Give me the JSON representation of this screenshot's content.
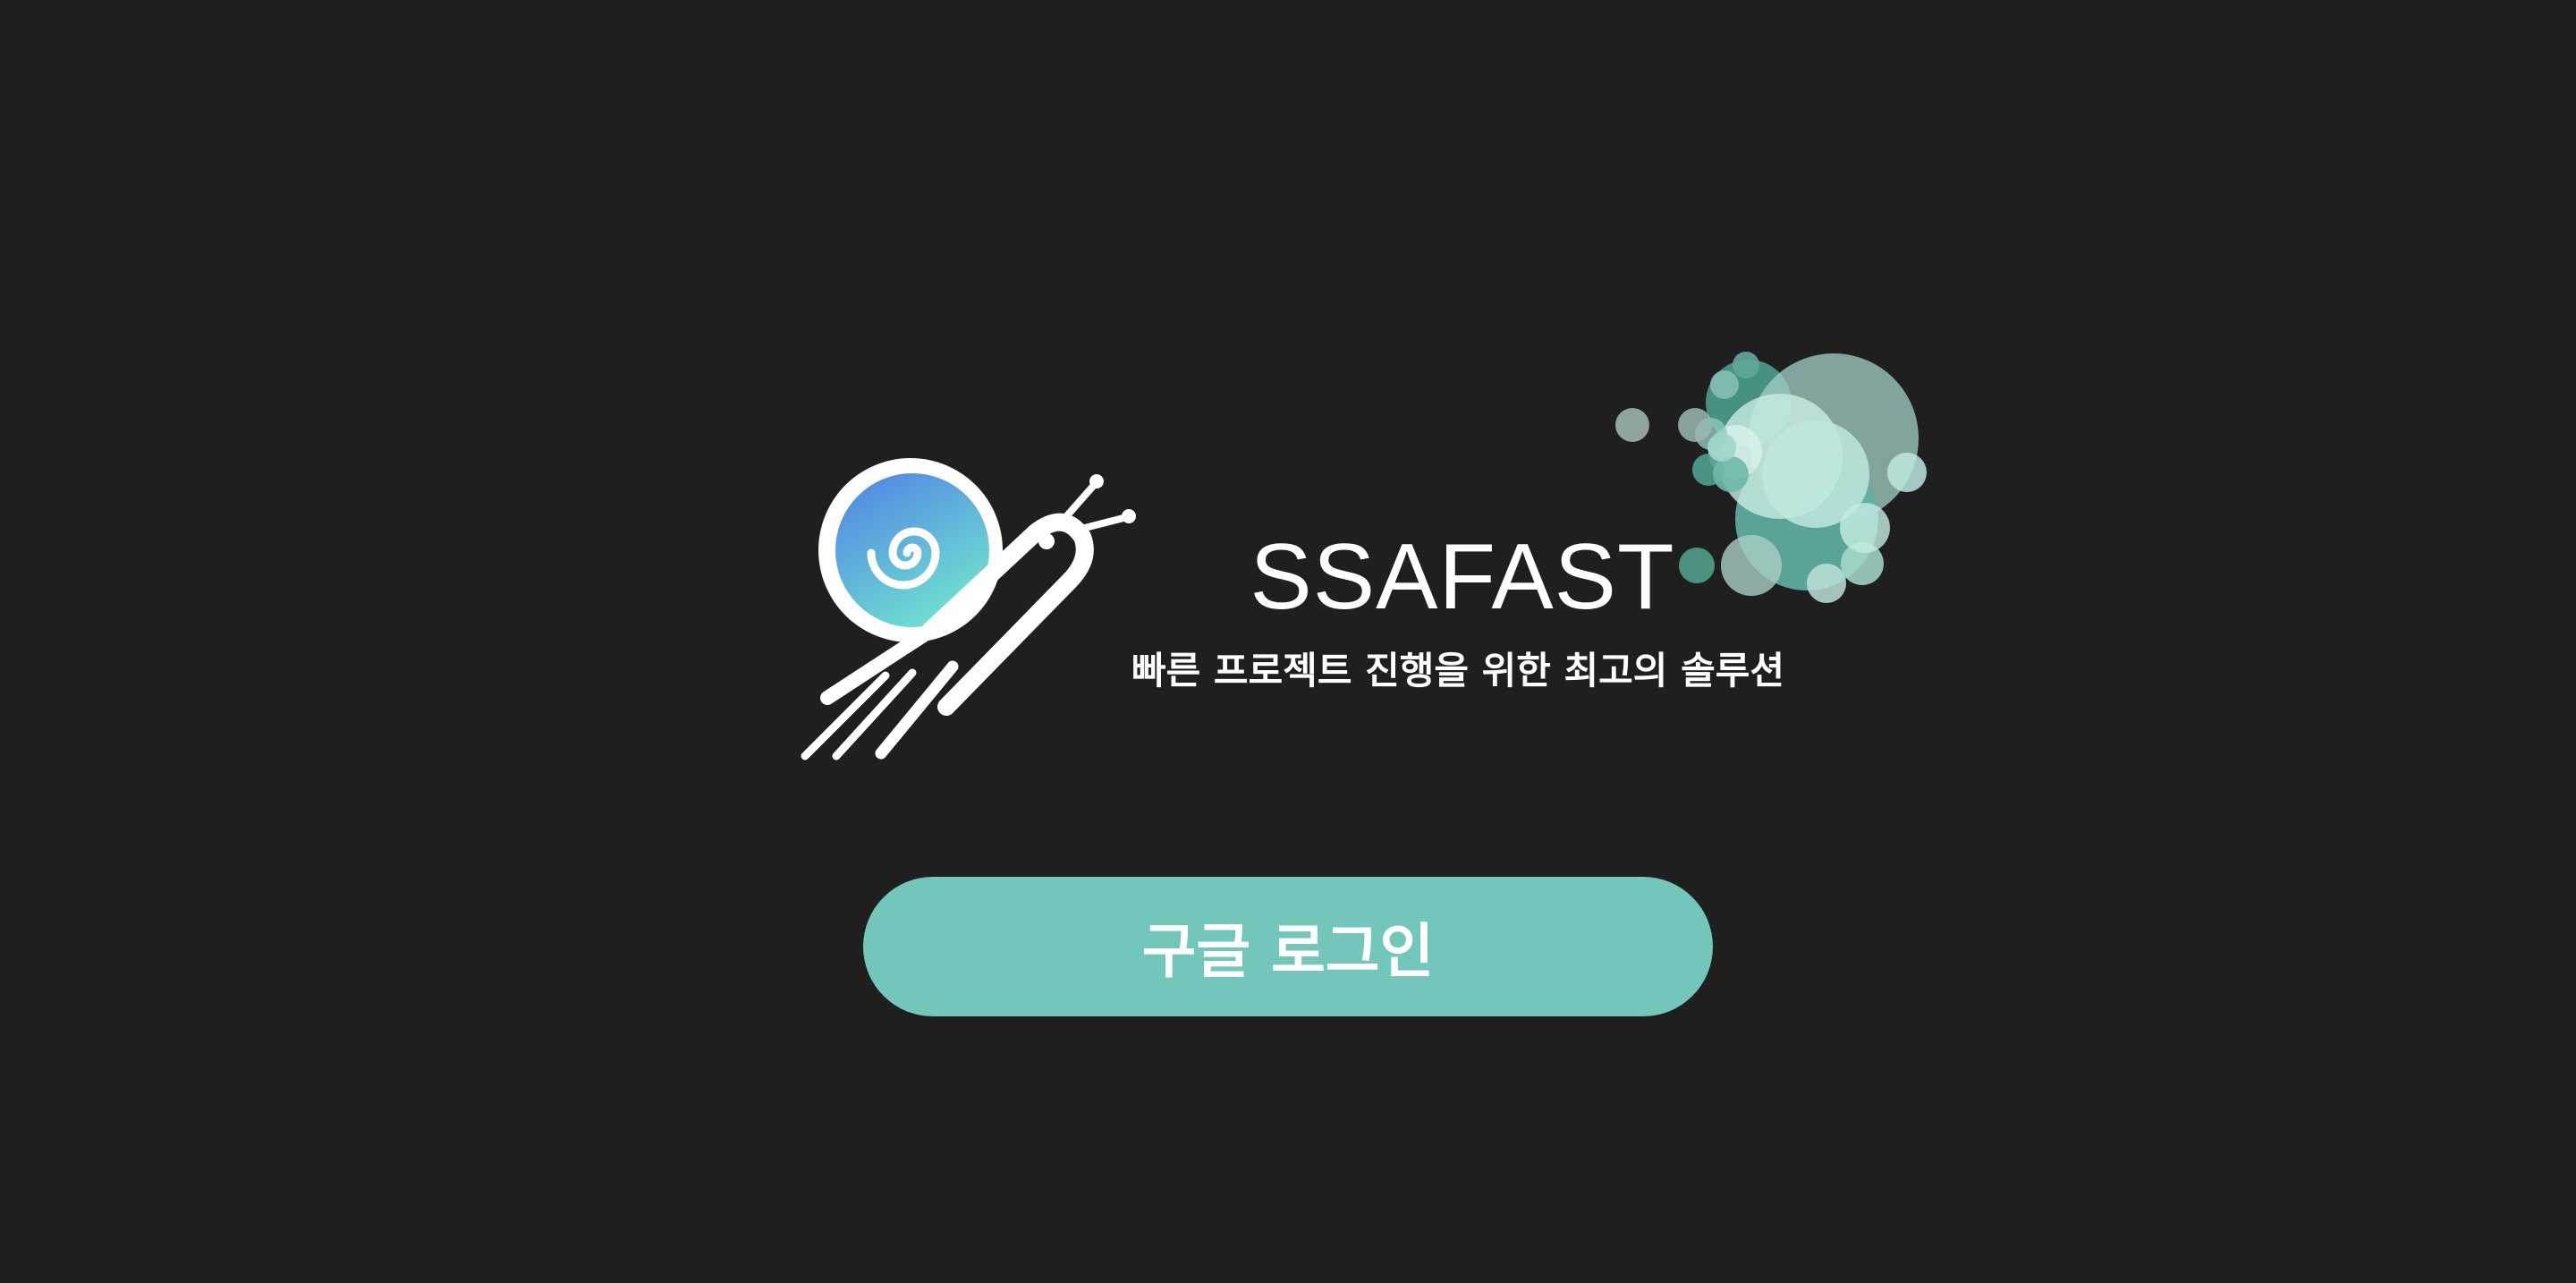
{
  "app": {
    "title": "SSAFAST",
    "subtitle": "빠른 프로젝트 진행을 위한 최고의 솔루션"
  },
  "login": {
    "google_label": "구글 로그인"
  },
  "icons": {
    "logo": "snail-logo-icon",
    "decoration": "bubbles-decoration"
  },
  "colors": {
    "background": "#1f1f1f",
    "accent": "#72c7ba",
    "text": "#ffffff",
    "shell_gradient_start": "#4f7fe6",
    "shell_gradient_end": "#6fe0d0"
  }
}
